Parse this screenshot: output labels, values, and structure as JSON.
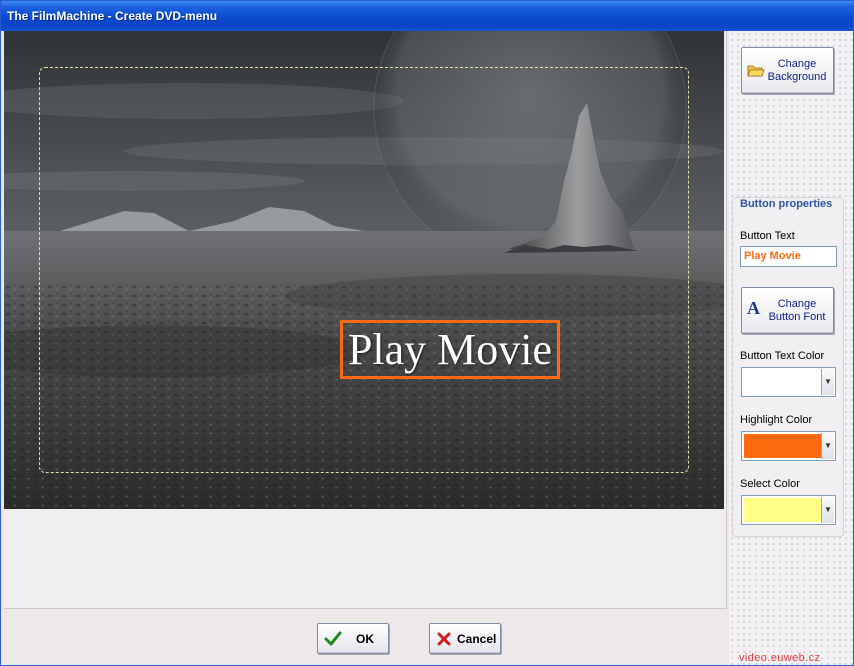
{
  "window": {
    "title": "The FilmMachine - Create DVD-menu"
  },
  "preview": {
    "menu_button_text": "Play Movie",
    "safe_frame_color": "#e6e0a2",
    "highlight_border_color": "#ff6a10"
  },
  "side_panel": {
    "change_background_label_line1": "Change",
    "change_background_label_line2": "Background",
    "change_background_icon": "open-folder-icon",
    "group_title": "Button properties",
    "button_text_label": "Button Text",
    "button_text_value": "Play Movie",
    "change_font_label_line1": "Change",
    "change_font_label_line2": "Button Font",
    "change_font_icon": "font-a-icon",
    "button_text_color_label": "Button Text Color",
    "button_text_color": "#ffffff",
    "highlight_color_label": "Highlight Color",
    "highlight_color": "#ff6a10",
    "select_color_label": "Select Color",
    "select_color": "#ffff88"
  },
  "footer": {
    "ok_label": "OK",
    "ok_icon": "checkmark-icon",
    "cancel_label": "Cancel",
    "cancel_icon": "x-icon"
  },
  "watermark": "video.euweb.cz"
}
